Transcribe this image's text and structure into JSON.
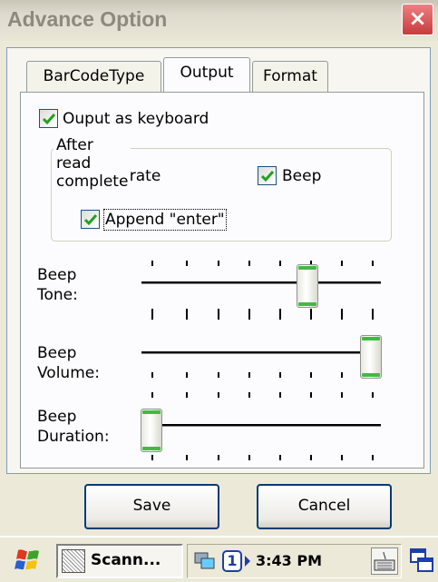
{
  "window": {
    "title": "Advance Option",
    "close_label": "×"
  },
  "tabs": [
    {
      "label": "BarCodeType"
    },
    {
      "label": "Output"
    },
    {
      "label": "Format"
    }
  ],
  "options": {
    "output_as_keyboard": {
      "label": "Ouput as keyboard",
      "checked": true
    },
    "group_title": "After read complete",
    "vibrate": {
      "label": "Vibrate",
      "checked": true
    },
    "beep": {
      "label": "Beep",
      "checked": true
    },
    "append_enter": {
      "label": "Append \"enter\"",
      "checked": true
    }
  },
  "sliders": [
    {
      "label_line1": "Beep",
      "label_line2": "Tone:",
      "value_fraction": 0.71
    },
    {
      "label_line1": "Beep",
      "label_line2": "Volume:",
      "value_fraction": 1.0
    },
    {
      "label_line1": "Beep",
      "label_line2": "Duration:",
      "value_fraction": 0.0
    }
  ],
  "buttons": {
    "save": "Save",
    "cancel": "Cancel"
  },
  "taskbar": {
    "app_label": "Scann...",
    "badge": "1",
    "time": "3:43 PM"
  },
  "colors": {
    "accent_check": "#21a121",
    "focus_border": "#003c74",
    "close": "#c63c3e"
  }
}
